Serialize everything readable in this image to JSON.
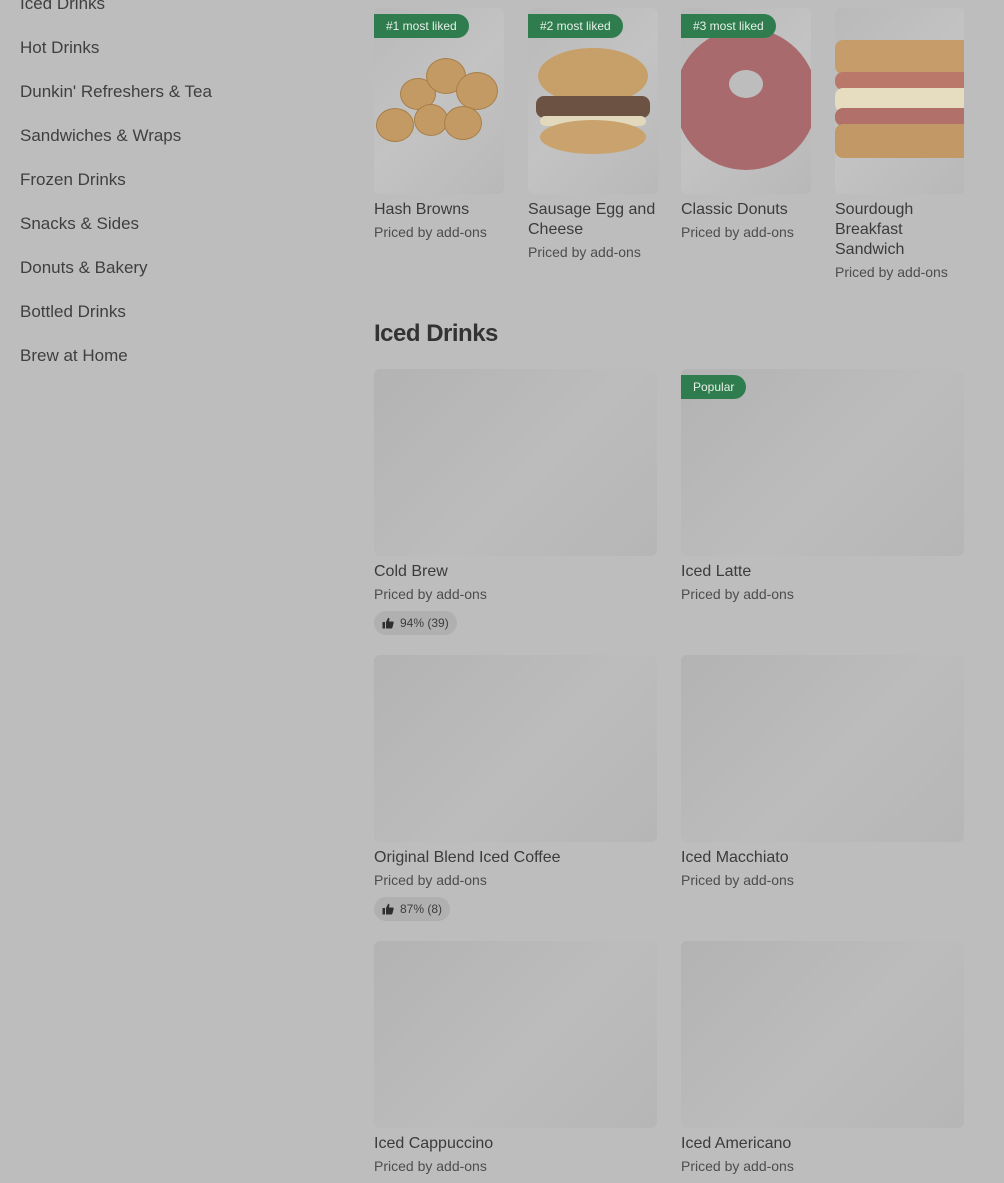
{
  "sidebar": {
    "items": [
      {
        "label": "Iced Drinks"
      },
      {
        "label": "Hot Drinks"
      },
      {
        "label": "Dunkin' Refreshers & Tea"
      },
      {
        "label": "Sandwiches & Wraps"
      },
      {
        "label": "Frozen Drinks"
      },
      {
        "label": "Snacks & Sides"
      },
      {
        "label": "Donuts & Bakery"
      },
      {
        "label": "Bottled Drinks"
      },
      {
        "label": "Brew at Home"
      }
    ]
  },
  "most_liked": [
    {
      "badge": "#1 most liked",
      "title": "Hash Browns",
      "price": "Priced by add-ons"
    },
    {
      "badge": "#2 most liked",
      "title": "Sausage Egg and Cheese",
      "price": "Priced by add-ons"
    },
    {
      "badge": "#3 most liked",
      "title": "Classic Donuts",
      "price": "Priced by add-ons"
    },
    {
      "badge": "",
      "title": "Sourdough Breakfast Sandwich",
      "price": "Priced by add-ons"
    }
  ],
  "iced_drinks": {
    "title": "Iced Drinks",
    "items": [
      {
        "title": "Cold Brew",
        "price": "Priced by add-ons",
        "rating": "94% (39)",
        "badge": ""
      },
      {
        "title": "Iced Latte",
        "price": "Priced by add-ons",
        "rating": "",
        "badge": "Popular"
      },
      {
        "title": "Original Blend Iced Coffee",
        "price": "Priced by add-ons",
        "rating": "87% (8)",
        "badge": ""
      },
      {
        "title": "Iced Macchiato",
        "price": "Priced by add-ons",
        "rating": "",
        "badge": ""
      },
      {
        "title": "Iced Cappuccino",
        "price": "Priced by add-ons",
        "rating": "",
        "badge": ""
      },
      {
        "title": "Iced Americano",
        "price": "Priced by add-ons",
        "rating": "",
        "badge": ""
      }
    ]
  },
  "colors": {
    "badge_green": "#2f7d4e",
    "overlay": "#bdbdbd"
  },
  "icons": {
    "rating": "thumbs-up-icon"
  }
}
